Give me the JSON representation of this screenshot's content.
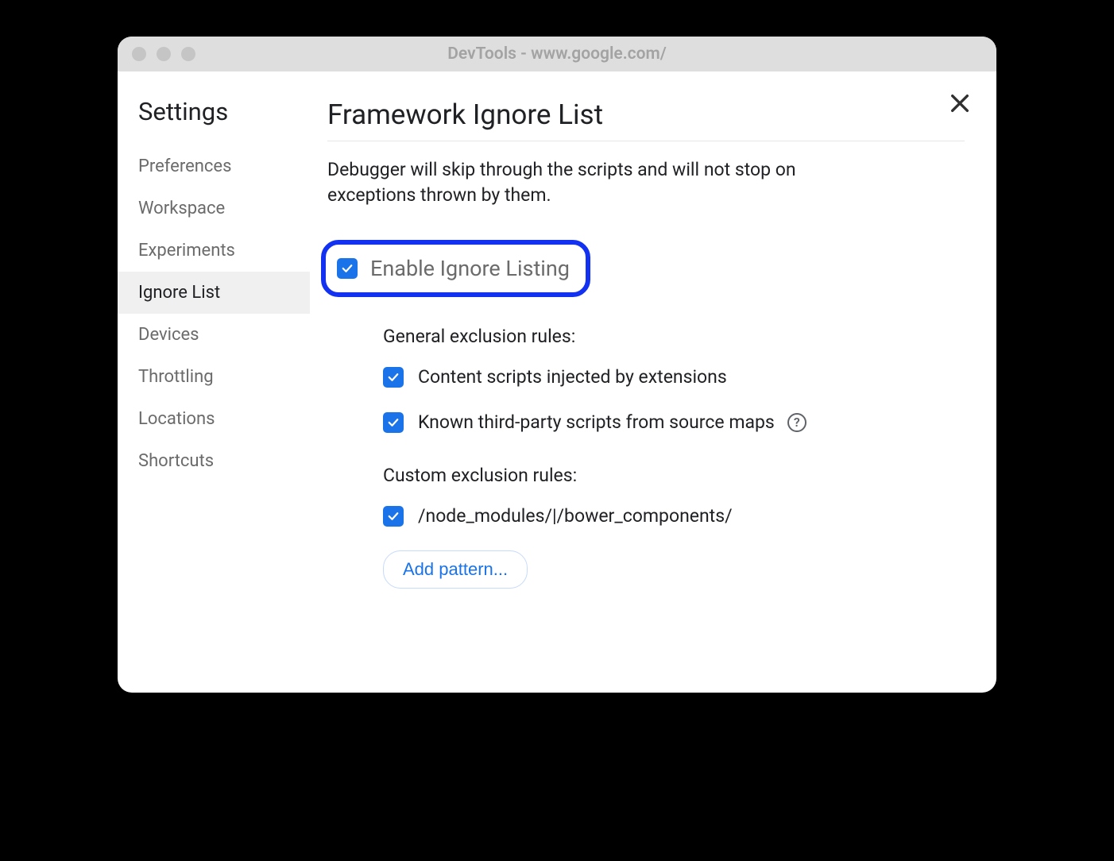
{
  "window": {
    "title": "DevTools - www.google.com/"
  },
  "sidebar": {
    "title": "Settings",
    "items": [
      {
        "label": "Preferences",
        "active": false
      },
      {
        "label": "Workspace",
        "active": false
      },
      {
        "label": "Experiments",
        "active": false
      },
      {
        "label": "Ignore List",
        "active": true
      },
      {
        "label": "Devices",
        "active": false
      },
      {
        "label": "Throttling",
        "active": false
      },
      {
        "label": "Locations",
        "active": false
      },
      {
        "label": "Shortcuts",
        "active": false
      }
    ]
  },
  "main": {
    "title": "Framework Ignore List",
    "description": "Debugger will skip through the scripts and will not stop on exceptions thrown by them.",
    "enable_label": "Enable Ignore Listing",
    "enable_checked": true,
    "general_section_title": "General exclusion rules:",
    "general_rules": [
      {
        "label": "Content scripts injected by extensions",
        "checked": true,
        "help": false
      },
      {
        "label": "Known third-party scripts from source maps",
        "checked": true,
        "help": true
      }
    ],
    "custom_section_title": "Custom exclusion rules:",
    "custom_rules": [
      {
        "label": "/node_modules/|/bower_components/",
        "checked": true
      }
    ],
    "add_button_label": "Add pattern..."
  }
}
